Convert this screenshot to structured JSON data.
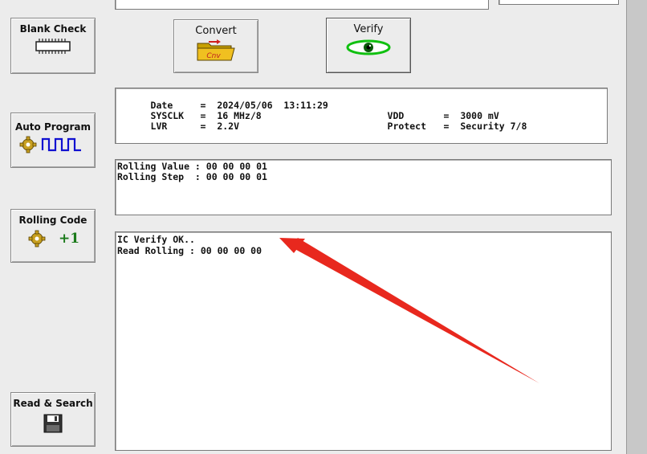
{
  "buttons": {
    "blank_check": "Blank Check",
    "convert": "Convert",
    "verify": "Verify",
    "auto_program": "Auto Program",
    "rolling_code": "Rolling Code",
    "rolling_code_plus": "+1",
    "read_search": "Read & Search",
    "convert_icon_text": "Cnv"
  },
  "info": {
    "date_label": "Date",
    "date_value": "=  2024/05/06  13:11:29",
    "sysclk_label": "SYSCLK",
    "sysclk_value": "=  16 MHz/8",
    "vdd_label": "VDD",
    "vdd_value": "=  3000 mV",
    "lvr_label": "LVR",
    "lvr_value": "=  2.2V",
    "protect_label": "Protect",
    "protect_value": "=  Security 7/8"
  },
  "rolling": {
    "line1": "Rolling Value : 00 00 00 01",
    "line2": "Rolling Step  : 00 00 00 01"
  },
  "log": {
    "line1": "IC Verify OK..",
    "line2": "Read Rolling : 00 00 00 00"
  },
  "colors": {
    "annotation_arrow": "#e8281e",
    "wave_blue": "#1010d0",
    "plus_green": "#1a7a1a"
  }
}
